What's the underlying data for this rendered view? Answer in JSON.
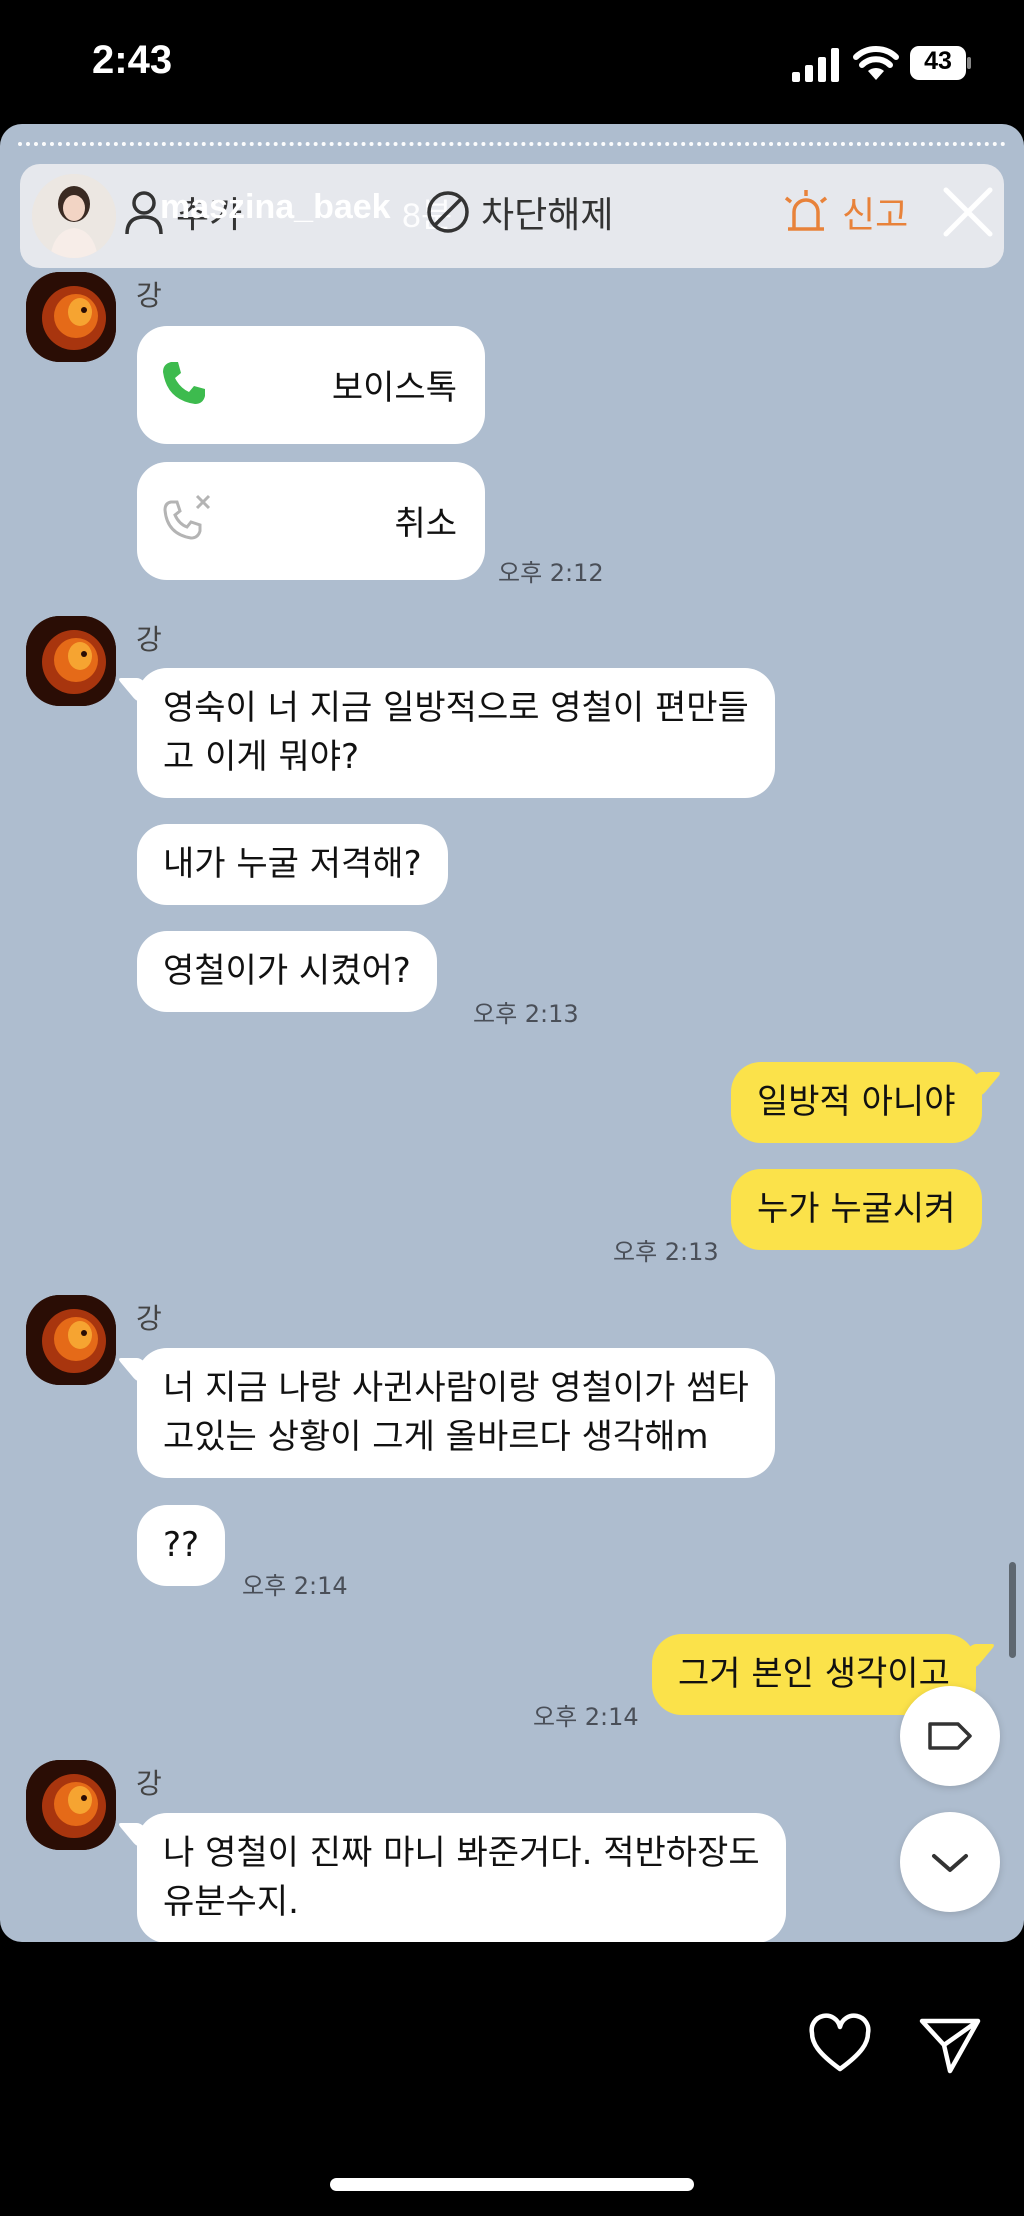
{
  "status_bar": {
    "time": "2:43",
    "battery": "43"
  },
  "story_header": {
    "username": "maszina_baek",
    "age": "8분",
    "friend_add": "추가",
    "unblock": "차단해제",
    "report": "신고"
  },
  "chat": {
    "sender_name": "강",
    "calls": [
      {
        "label": "보이스톡",
        "status": "connected"
      },
      {
        "label": "취소",
        "status": "cancelled"
      }
    ],
    "messages": {
      "m1": "영숙이 너 지금 일방적으로 영철이 편만들\n고 이게 뭐야?",
      "m2": "내가 누굴 저격해?",
      "m3": "영철이가 시켰어?",
      "m4": "일방적 아니야",
      "m5": "누가 누굴시켜",
      "m6": "너 지금 나랑 사귄사람이랑 영철이가 썸타\n고있는 상황이 그게 올바르다 생각해m",
      "m7": "??",
      "m8": "그거 본인 생각이고",
      "m9": "나 영철이 진짜 마니 봐준거다. 적반하장도\n유분수지."
    },
    "timestamps": {
      "t1": "오후 2:12",
      "t2": "오후 2:13",
      "t3": "오후 2:13",
      "t4": "오후 2:14",
      "t5": "오후 2:14"
    }
  },
  "colors": {
    "chat_background": "#aebdcf",
    "outgoing_bubble": "#fbe24a",
    "incoming_bubble": "#ffffff",
    "report_accent": "#e8823a",
    "call_green": "#3dbb4e"
  },
  "icons": [
    "person-add-icon",
    "block-icon",
    "siren-icon",
    "close-icon",
    "phone-icon",
    "phone-cancelled-icon",
    "tag-icon",
    "chevron-down-icon",
    "heart-icon",
    "send-icon"
  ]
}
